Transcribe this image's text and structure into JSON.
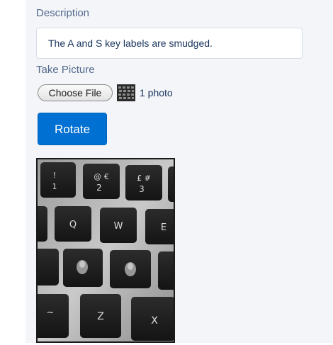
{
  "form": {
    "description_label": "Description",
    "description_value": "The A and S key labels are smudged.",
    "picture_label": "Take Picture",
    "choose_file_label": "Choose File",
    "file_count": "1 photo",
    "rotate_label": "Rotate"
  },
  "photo": {
    "keys_row1": [
      {
        "top": "!",
        "bottom": "1"
      },
      {
        "top": "@ €",
        "bottom": "2"
      },
      {
        "top": "£ #",
        "bottom": "3"
      }
    ],
    "keys_row2": [
      "Q",
      "W",
      "E"
    ],
    "keys_row4": [
      "~",
      "Z",
      "X"
    ]
  },
  "colors": {
    "accent": "#0070d2",
    "label": "#54698d",
    "panel_bg": "#f3f5f8"
  }
}
